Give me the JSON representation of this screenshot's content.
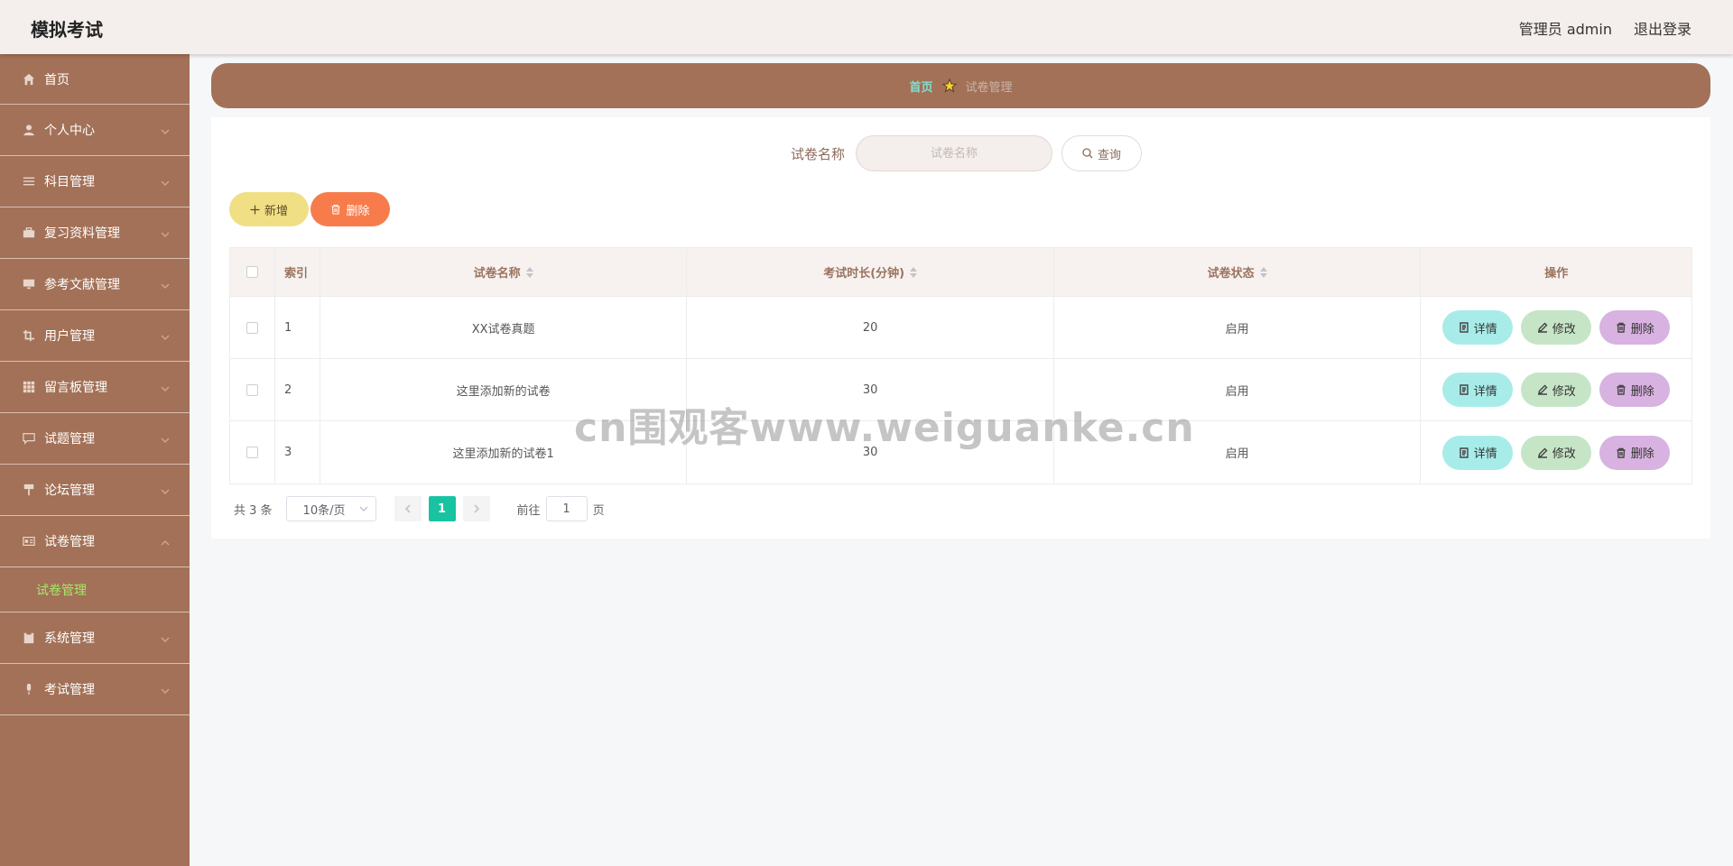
{
  "header": {
    "app_title": "模拟考试",
    "admin_label": "管理员 admin",
    "logout_label": "退出登录"
  },
  "sidebar": {
    "items": [
      {
        "label": "首页",
        "icon": "home-icon"
      },
      {
        "label": "个人中心",
        "icon": "user-icon"
      },
      {
        "label": "科目管理",
        "icon": "list-icon"
      },
      {
        "label": "复习资料管理",
        "icon": "briefcase-icon"
      },
      {
        "label": "参考文献管理",
        "icon": "monitor-icon"
      },
      {
        "label": "用户管理",
        "icon": "crop-icon"
      },
      {
        "label": "留言板管理",
        "icon": "grid-icon"
      },
      {
        "label": "试题管理",
        "icon": "comment-icon"
      },
      {
        "label": "论坛管理",
        "icon": "pin-icon"
      },
      {
        "label": "试卷管理",
        "icon": "id-card-icon"
      },
      {
        "label": "系统管理",
        "icon": "clipboard-icon"
      },
      {
        "label": "考试管理",
        "icon": "mic-icon"
      }
    ],
    "submenu_label": "试卷管理"
  },
  "breadcrumb": {
    "home": "首页",
    "current": "试卷管理"
  },
  "search": {
    "label": "试卷名称",
    "placeholder": "试卷名称",
    "button": "查询"
  },
  "actions": {
    "add": "新增",
    "delete": "删除"
  },
  "table": {
    "headers": {
      "index": "索引",
      "name": "试卷名称",
      "duration": "考试时长(分钟)",
      "status": "试卷状态",
      "ops": "操作"
    },
    "rows": [
      {
        "index": "1",
        "name": "XX试卷真题",
        "duration": "20",
        "status": "启用"
      },
      {
        "index": "2",
        "name": "这里添加新的试卷",
        "duration": "30",
        "status": "启用"
      },
      {
        "index": "3",
        "name": "这里添加新的试卷1",
        "duration": "30",
        "status": "启用"
      }
    ],
    "op_labels": {
      "detail": "详情",
      "edit": "修改",
      "delete": "删除"
    }
  },
  "pagination": {
    "total": "共 3 条",
    "page_size": "10条/页",
    "current_page": "1",
    "goto_prefix": "前往",
    "goto_value": "1",
    "goto_suffix": "页"
  },
  "watermark": "cn围观客www.weiguanke.cn",
  "colors": {
    "sidebar": "#a37157",
    "header": "#f4eeec",
    "active_page": "#19c3a2",
    "add_button": "#f1df85",
    "delete_button": "#f87c4b"
  }
}
